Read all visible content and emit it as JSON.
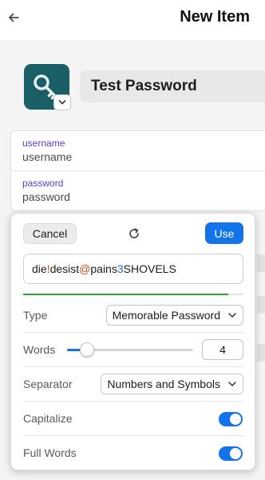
{
  "header": {
    "title": "New Item",
    "back_icon": "arrow-left-icon"
  },
  "item": {
    "icon": "key-icon",
    "icon_color": "#1a5e66",
    "title": "Test Password"
  },
  "fields": [
    {
      "label": "username",
      "value": "username"
    },
    {
      "label": "password",
      "value": "password"
    }
  ],
  "generator": {
    "cancel_label": "Cancel",
    "refresh_icon": "refresh-icon",
    "use_label": "Use",
    "password_parts": [
      {
        "text": "die",
        "kind": "plain"
      },
      {
        "text": "!",
        "kind": "sym"
      },
      {
        "text": "desist",
        "kind": "plain"
      },
      {
        "text": "@",
        "kind": "sym"
      },
      {
        "text": "pains",
        "kind": "plain"
      },
      {
        "text": "3",
        "kind": "num"
      },
      {
        "text": "SHOVELS",
        "kind": "plain"
      }
    ],
    "strength_fraction": 0.93,
    "strength_color": "#2ba633",
    "type": {
      "label": "Type",
      "value": "Memorable Password"
    },
    "words": {
      "label": "Words",
      "value": "4",
      "min": 3,
      "max": 15,
      "current": 4
    },
    "separator": {
      "label": "Separator",
      "value": "Numbers and Symbols"
    },
    "capitalize": {
      "label": "Capitalize",
      "on": true
    },
    "full_words": {
      "label": "Full Words",
      "on": true
    },
    "accent_color": "#1373e8"
  }
}
